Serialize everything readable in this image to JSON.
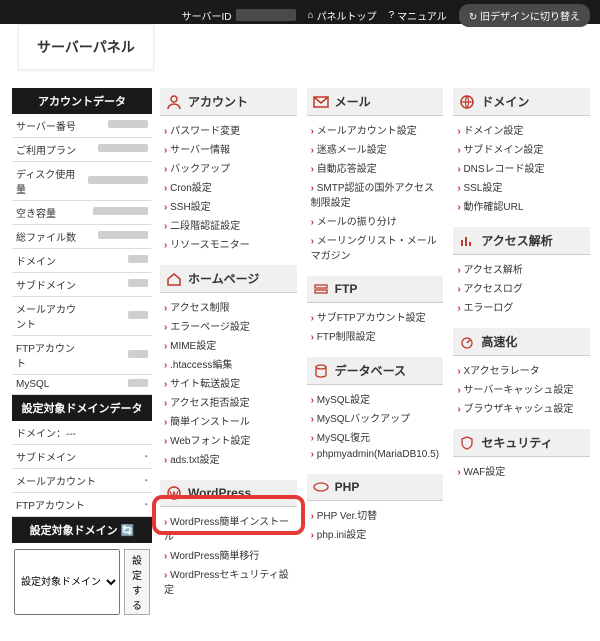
{
  "topbar": {
    "server_id_label": "サーバーID",
    "panel_top": "パネルトップ",
    "manual": "マニュアル",
    "old_design": "旧デザインに切り替え"
  },
  "header": {
    "title": "サーバーパネル"
  },
  "sidebar": {
    "account_data": {
      "title": "アカウントデータ",
      "rows": [
        {
          "label": "サーバー番号",
          "w": 40
        },
        {
          "label": "ご利用プラン",
          "w": 50
        },
        {
          "label": "ディスク使用量",
          "w": 60
        },
        {
          "label": "空き容量",
          "w": 55
        },
        {
          "label": "総ファイル数",
          "w": 50
        },
        {
          "label": "ドメイン",
          "w": 20
        },
        {
          "label": "サブドメイン",
          "w": 20
        },
        {
          "label": "メールアカウント",
          "w": 20
        },
        {
          "label": "FTPアカウント",
          "w": 20
        },
        {
          "label": "MySQL",
          "w": 20
        }
      ]
    },
    "domain_data": {
      "title": "設定対象ドメインデータ",
      "rows": [
        {
          "label": "ドメイン：---",
          "val": ""
        },
        {
          "label": "サブドメイン",
          "val": "-"
        },
        {
          "label": "メールアカウント",
          "val": "-"
        },
        {
          "label": "FTPアカウント",
          "val": "-"
        }
      ]
    },
    "domain_select": {
      "title": "設定対象ドメイン 🔄",
      "option": "設定対象ドメイン",
      "button": "設定する"
    }
  },
  "sections": [
    {
      "icon": "user",
      "title": "アカウント",
      "items": [
        "パスワード変更",
        "サーバー情報",
        "バックアップ",
        "Cron設定",
        "SSH設定",
        "二段階認証設定",
        "リソースモニター"
      ]
    },
    {
      "icon": "mail",
      "title": "メール",
      "items": [
        "メールアカウント設定",
        "迷惑メール設定",
        "自動応答設定",
        "SMTP認証の国外アクセス制限設定",
        "メールの振り分け",
        "メーリングリスト・メールマガジン"
      ]
    },
    {
      "icon": "globe",
      "title": "ドメイン",
      "items": [
        "ドメイン設定",
        "サブドメイン設定",
        "DNSレコード設定",
        "SSL設定",
        "動作確認URL"
      ]
    },
    {
      "icon": "home",
      "title": "ホームページ",
      "items": [
        "アクセス制限",
        "エラーページ設定",
        "MIME設定",
        ".htaccess編集",
        "サイト転送設定",
        "アクセス拒否設定",
        "簡単インストール",
        "Webフォント設定",
        "ads.txt設定"
      ]
    },
    {
      "icon": "ftp",
      "title": "FTP",
      "items": [
        "サブFTPアカウント設定",
        "FTP制限設定"
      ]
    },
    {
      "icon": "chart",
      "title": "アクセス解析",
      "items": [
        "アクセス解析",
        "アクセスログ",
        "エラーログ"
      ]
    },
    {
      "icon": "db",
      "title": "データベース",
      "items": [
        "MySQL設定",
        "MySQLバックアップ",
        "MySQL復元",
        "phpmyadmin(MariaDB10.5)"
      ]
    },
    {
      "icon": "speed",
      "title": "高速化",
      "items": [
        "Xアクセラレータ",
        "サーバーキャッシュ設定",
        "ブラウザキャッシュ設定"
      ]
    },
    {
      "icon": "wp",
      "title": "WordPress",
      "items": [
        "WordPress簡単インストール",
        "WordPress簡単移行",
        "WordPressセキュリティ設定"
      ],
      "highlight": 0
    },
    {
      "icon": "php",
      "title": "PHP",
      "items": [
        "PHP Ver.切替",
        "php.ini設定"
      ]
    },
    {
      "icon": "shield",
      "title": "セキュリティ",
      "items": [
        "WAF設定"
      ]
    }
  ]
}
